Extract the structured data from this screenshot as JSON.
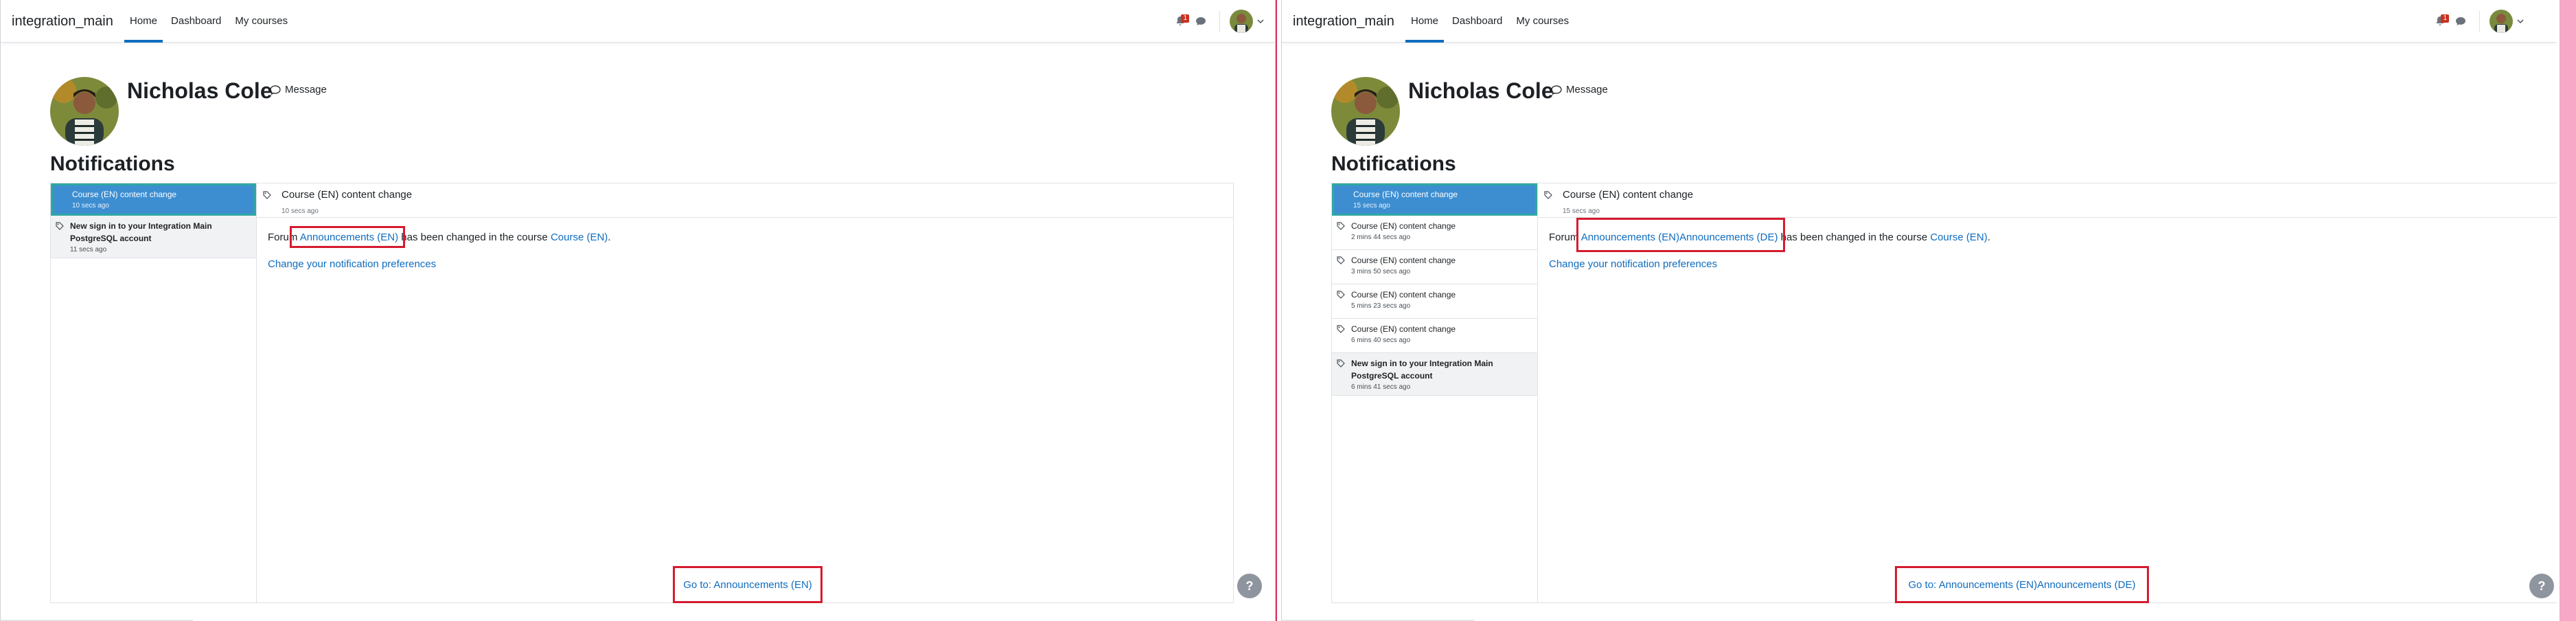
{
  "colors": {
    "accent": "#0f6cbf",
    "selected_bg": "#3d8ed1",
    "selected_border": "#2fa8a2",
    "badge": "#ca3120",
    "highlight_box": "#d51b2f"
  },
  "panels": [
    {
      "brand": "integration_main",
      "nav": [
        "Home",
        "Dashboard",
        "My courses"
      ],
      "notification_count": "1",
      "user_name": "Nicholas Cole",
      "message_label": "Message",
      "page_title": "Notifications",
      "list": [
        {
          "subject": "Course (EN) content change",
          "time": "10 secs ago",
          "state": "selected"
        },
        {
          "subject": "New sign in to your Integration Main PostgreSQL account",
          "time": "11 secs ago",
          "state": "unread"
        }
      ],
      "detail": {
        "subject": "Course (EN) content change",
        "time": "10 secs ago",
        "prefix": "Forum ",
        "forum_link": "Announcements (EN)",
        "middle": " has been changed in the course ",
        "course_link": "Course (EN)",
        "suffix": ".",
        "pref_link": "Change your notification preferences",
        "goto": "Go to: Announcements (EN)"
      }
    },
    {
      "brand": "integration_main",
      "nav": [
        "Home",
        "Dashboard",
        "My courses"
      ],
      "notification_count": "1",
      "user_name": "Nicholas Cole",
      "message_label": "Message",
      "page_title": "Notifications",
      "list": [
        {
          "subject": "Course (EN) content change",
          "time": "15 secs ago",
          "state": "selected"
        },
        {
          "subject": "Course (EN) content change",
          "time": "2 mins 44 secs ago",
          "state": "plain"
        },
        {
          "subject": "Course (EN) content change",
          "time": "3 mins 50 secs ago",
          "state": "plain"
        },
        {
          "subject": "Course (EN) content change",
          "time": "5 mins 23 secs ago",
          "state": "plain"
        },
        {
          "subject": "Course (EN) content change",
          "time": "6 mins 40 secs ago",
          "state": "plain"
        },
        {
          "subject": "New sign in to your Integration Main PostgreSQL account",
          "time": "6 mins 41 secs ago",
          "state": "unread"
        }
      ],
      "detail": {
        "subject": "Course (EN) content change",
        "time": "15 secs ago",
        "prefix": "Forum ",
        "forum_link": "Announcements (EN)Announcements (DE)",
        "middle": " has been changed in the course ",
        "course_link": "Course (EN)",
        "suffix": ".",
        "pref_link": "Change your notification preferences",
        "goto": "Go to: Announcements (EN)Announcements (DE)"
      }
    }
  ],
  "help_label": "?"
}
